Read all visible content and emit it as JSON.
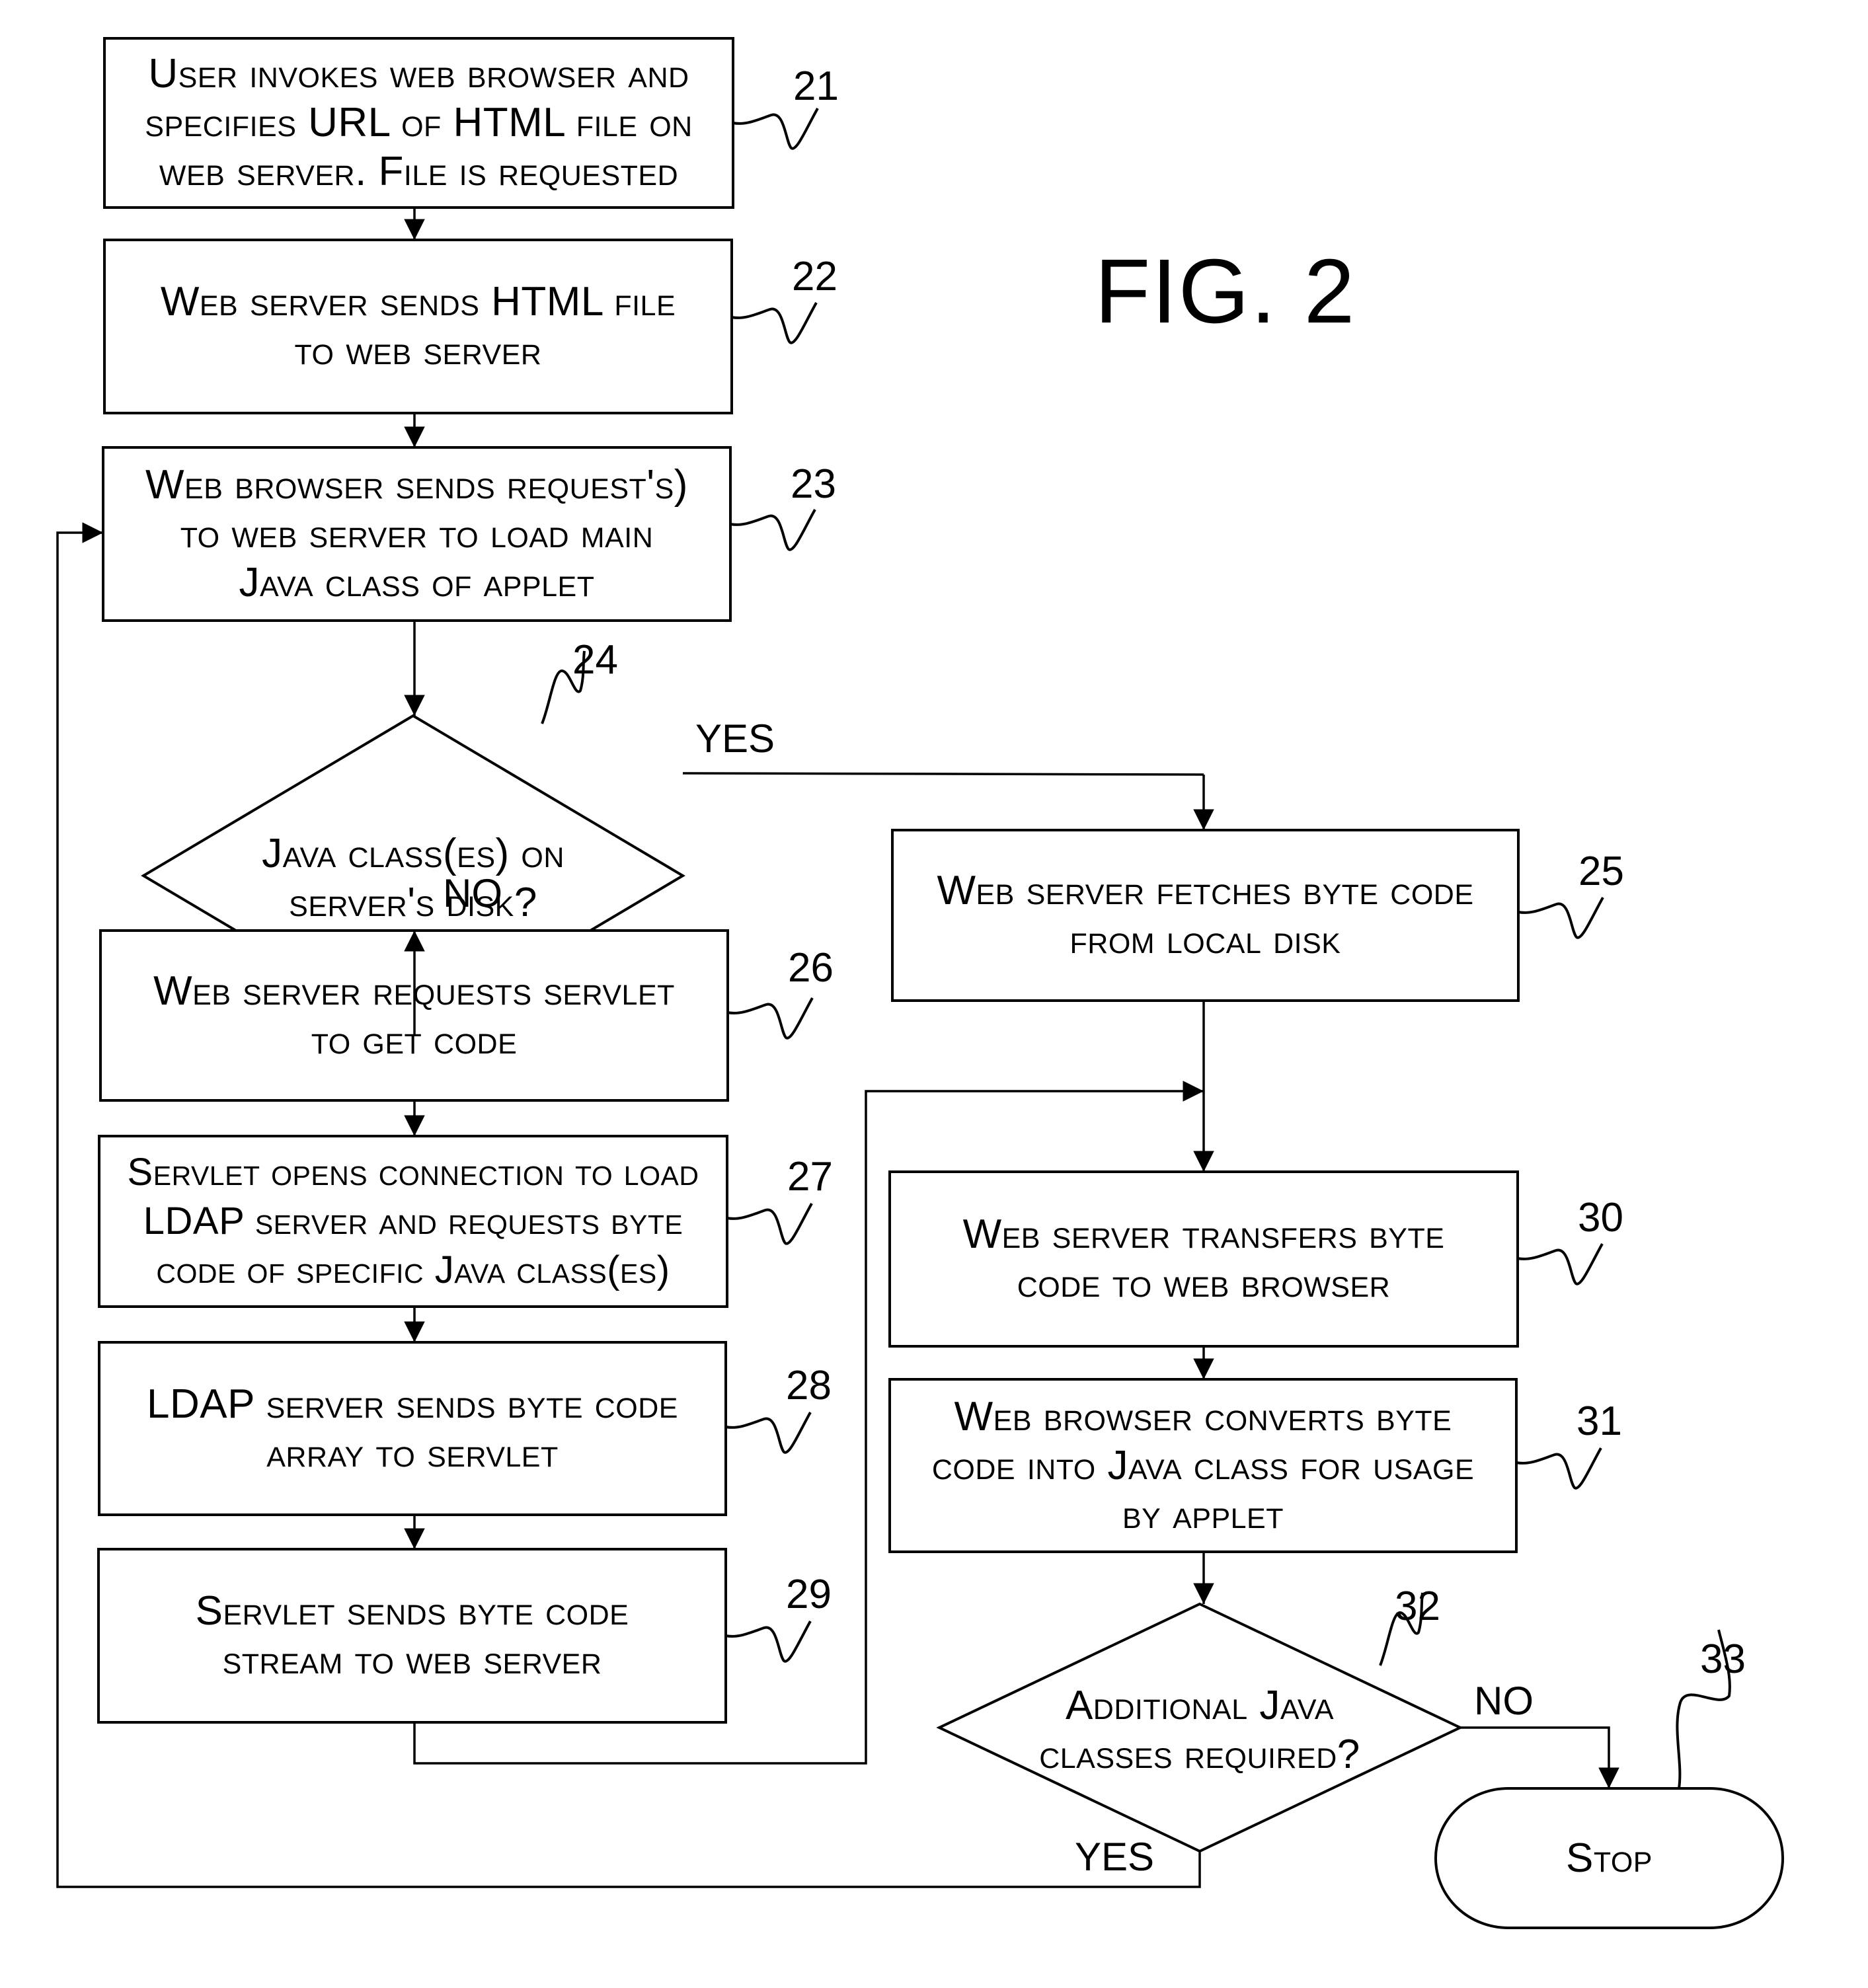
{
  "figure": {
    "title": "FIG. 2"
  },
  "nodes": [
    {
      "id": "21",
      "type": "process",
      "ref": "21",
      "lines": [
        "User invokes web browser and",
        "specifies URL of HTML file on",
        "web server. File is requested"
      ]
    },
    {
      "id": "22",
      "type": "process",
      "ref": "22",
      "lines": [
        "Web server sends HTML file",
        "to web server"
      ]
    },
    {
      "id": "23",
      "type": "process",
      "ref": "23",
      "lines": [
        "Web browser sends request's)",
        "to web server to load main",
        "Java class of applet"
      ]
    },
    {
      "id": "24",
      "type": "decision",
      "ref": "24",
      "lines": [
        "Java class(es) on",
        "server's disk?"
      ]
    },
    {
      "id": "25",
      "type": "process",
      "ref": "25",
      "lines": [
        "Web server fetches byte code",
        "from local disk"
      ]
    },
    {
      "id": "26",
      "type": "process",
      "ref": "26",
      "lines": [
        "Web server requests servlet",
        "to get code"
      ]
    },
    {
      "id": "27",
      "type": "process",
      "ref": "27",
      "lines": [
        "Servlet opens connection to load",
        "LDAP server and requests byte",
        "code of specific Java class(es)"
      ]
    },
    {
      "id": "28",
      "type": "process",
      "ref": "28",
      "lines": [
        "LDAP server sends byte code",
        "array to servlet"
      ]
    },
    {
      "id": "29",
      "type": "process",
      "ref": "29",
      "lines": [
        "Servlet sends byte code",
        "stream to web server"
      ]
    },
    {
      "id": "30",
      "type": "process",
      "ref": "30",
      "lines": [
        "Web server transfers byte",
        "code to web browser"
      ]
    },
    {
      "id": "31",
      "type": "process",
      "ref": "31",
      "lines": [
        "Web browser converts byte",
        "code into Java class for usage",
        "by applet"
      ]
    },
    {
      "id": "32",
      "type": "decision",
      "ref": "32",
      "lines": [
        "Additional Java",
        "classes required?"
      ]
    },
    {
      "id": "33",
      "type": "terminal",
      "ref": "33",
      "lines": [
        "Stop"
      ]
    }
  ],
  "edges": [
    {
      "from": "21",
      "to": "22",
      "label": ""
    },
    {
      "from": "22",
      "to": "23",
      "label": ""
    },
    {
      "from": "23",
      "to": "24",
      "label": ""
    },
    {
      "from": "24",
      "to": "25",
      "label": "YES"
    },
    {
      "from": "24",
      "to": "26",
      "label": "NO"
    },
    {
      "from": "26",
      "to": "27",
      "label": ""
    },
    {
      "from": "27",
      "to": "28",
      "label": ""
    },
    {
      "from": "28",
      "to": "29",
      "label": ""
    },
    {
      "from": "29",
      "to": "30",
      "label": ""
    },
    {
      "from": "25",
      "to": "30",
      "label": ""
    },
    {
      "from": "30",
      "to": "31",
      "label": ""
    },
    {
      "from": "31",
      "to": "32",
      "label": ""
    },
    {
      "from": "32",
      "to": "33",
      "label": "NO"
    },
    {
      "from": "32",
      "to": "23",
      "label": "YES"
    }
  ],
  "edge_labels": {
    "d24_yes": "YES",
    "d24_no": "NO",
    "d32_no": "NO",
    "d32_yes": "YES"
  }
}
